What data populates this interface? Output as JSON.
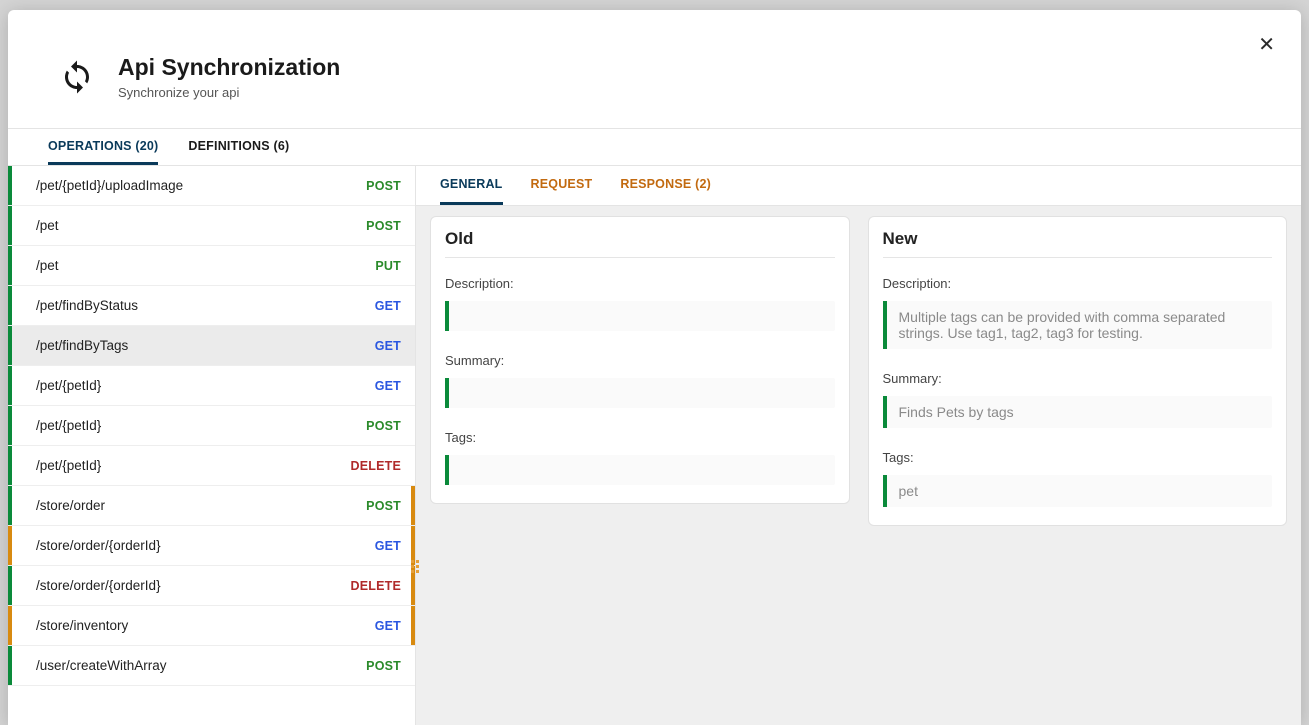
{
  "modal": {
    "title": "Api Synchronization",
    "subtitle": "Synchronize your api"
  },
  "top_tabs": {
    "operations": "OPERATIONS (20)",
    "definitions": "DEFINITIONS (6)"
  },
  "operations": [
    {
      "path": "/pet/{petId}/uploadImage",
      "method": "POST",
      "status": "green",
      "right": ""
    },
    {
      "path": "/pet",
      "method": "POST",
      "status": "green",
      "right": ""
    },
    {
      "path": "/pet",
      "method": "PUT",
      "status": "green",
      "right": ""
    },
    {
      "path": "/pet/findByStatus",
      "method": "GET",
      "status": "green",
      "right": ""
    },
    {
      "path": "/pet/findByTags",
      "method": "GET",
      "status": "green",
      "right": "",
      "selected": true
    },
    {
      "path": "/pet/{petId}",
      "method": "GET",
      "status": "green",
      "right": ""
    },
    {
      "path": "/pet/{petId}",
      "method": "POST",
      "status": "green",
      "right": ""
    },
    {
      "path": "/pet/{petId}",
      "method": "DELETE",
      "status": "green",
      "right": ""
    },
    {
      "path": "/store/order",
      "method": "POST",
      "status": "green",
      "right": "orange"
    },
    {
      "path": "/store/order/{orderId}",
      "method": "GET",
      "status": "orange",
      "right": "orange"
    },
    {
      "path": "/store/order/{orderId}",
      "method": "DELETE",
      "status": "green",
      "right": "orange"
    },
    {
      "path": "/store/inventory",
      "method": "GET",
      "status": "orange",
      "right": "orange"
    },
    {
      "path": "/user/createWithArray",
      "method": "POST",
      "status": "green",
      "right": ""
    }
  ],
  "detail_tabs": {
    "general": "GENERAL",
    "request": "REQUEST",
    "response": "RESPONSE (2)"
  },
  "panels": {
    "old": {
      "title": "Old",
      "description_label": "Description:",
      "description_value": "",
      "summary_label": "Summary:",
      "summary_value": "",
      "tags_label": "Tags:",
      "tags_value": ""
    },
    "new": {
      "title": "New",
      "description_label": "Description:",
      "description_value": "Multiple tags can be provided with comma separated strings. Use tag1, tag2, tag3 for testing.",
      "summary_label": "Summary:",
      "summary_value": "Finds Pets by tags",
      "tags_label": "Tags:",
      "tags_value": "pet"
    }
  }
}
